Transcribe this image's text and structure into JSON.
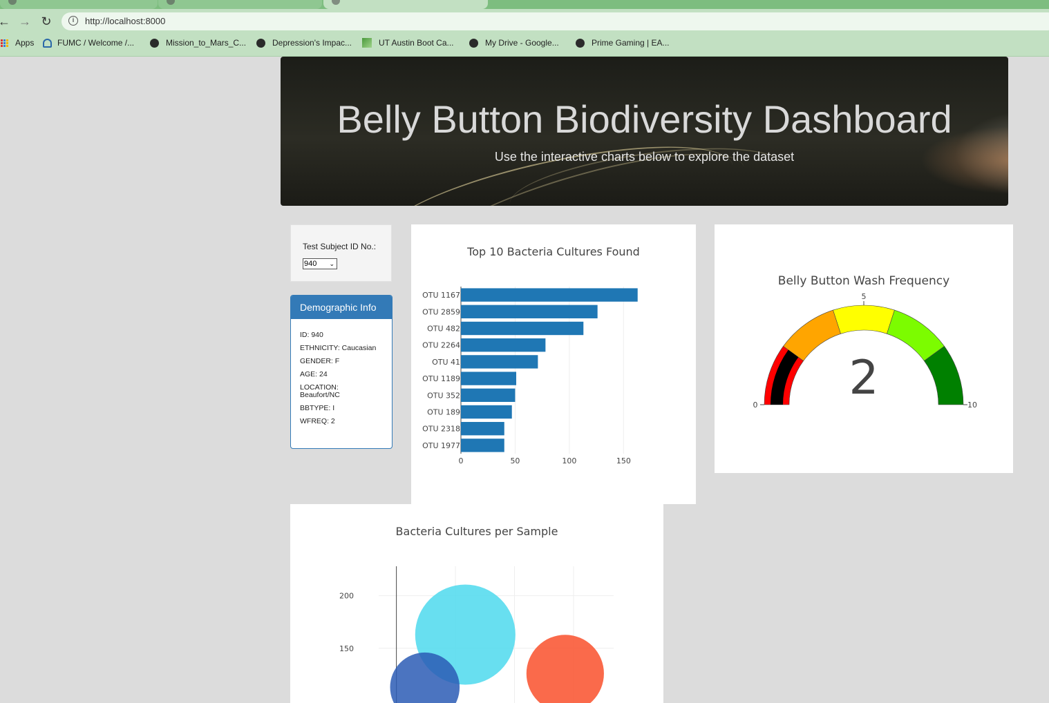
{
  "browser": {
    "url": "http://localhost:8000",
    "bookmarks": [
      {
        "label": "Apps",
        "icon": "apps-grid-icon"
      },
      {
        "label": "FUMC / Welcome /...",
        "icon": "fumc-logo-icon"
      },
      {
        "label": "Mission_to_Mars_C...",
        "icon": "globe-icon"
      },
      {
        "label": "Depression's Impac...",
        "icon": "globe-icon"
      },
      {
        "label": "UT Austin Boot Ca...",
        "icon": "ut-bootcamp-icon"
      },
      {
        "label": "My Drive - Google...",
        "icon": "globe-icon"
      },
      {
        "label": "Prime Gaming | EA...",
        "icon": "globe-icon"
      }
    ]
  },
  "header": {
    "title": "Belly Button Biodiversity Dashboard",
    "subtitle": "Use the interactive charts below to explore the dataset"
  },
  "selector": {
    "label": "Test Subject ID No.:",
    "value": "940"
  },
  "demographics": {
    "heading": "Demographic Info",
    "rows": [
      "ID: 940",
      "ETHNICITY: Caucasian",
      "GENDER: F",
      "AGE: 24",
      "LOCATION: Beaufort/NC",
      "BBTYPE: I",
      "WFREQ: 2"
    ]
  },
  "chart_data": [
    {
      "type": "bar",
      "orientation": "horizontal",
      "title": "Top 10 Bacteria Cultures Found",
      "categories": [
        "OTU 1167",
        "OTU 2859",
        "OTU 482",
        "OTU 2264",
        "OTU 41",
        "OTU 1189",
        "OTU 352",
        "OTU 189",
        "OTU 2318",
        "OTU 1977"
      ],
      "values": [
        163,
        126,
        113,
        78,
        71,
        51,
        50,
        47,
        40,
        40
      ],
      "xlim": [
        0,
        167
      ],
      "xticks": [
        0,
        50,
        100,
        150
      ],
      "grid": "vertical",
      "color": "#1f77b4"
    },
    {
      "type": "gauge",
      "title": "Belly Button Wash Frequency",
      "value": 2,
      "range": [
        0,
        10
      ],
      "ticks": [
        0,
        5,
        10
      ],
      "steps": [
        {
          "range": [
            0,
            2
          ],
          "color": "#ff0000"
        },
        {
          "range": [
            2,
            4
          ],
          "color": "#ffa500"
        },
        {
          "range": [
            4,
            6
          ],
          "color": "#ffff00"
        },
        {
          "range": [
            6,
            8
          ],
          "color": "#7cfc00"
        },
        {
          "range": [
            8,
            10
          ],
          "color": "#008000"
        }
      ],
      "bar_color": "#000000"
    },
    {
      "type": "scatter",
      "mode": "bubble",
      "title": "Bacteria Cultures per Sample",
      "yticks": [
        150,
        200
      ],
      "ylim": [
        98,
        228
      ],
      "xlim": [
        -300,
        3680
      ],
      "grid": true,
      "points": [
        {
          "x": 1167,
          "y": 163,
          "size": 163,
          "color": "#4dd9ed"
        },
        {
          "x": 482,
          "y": 113,
          "size": 113,
          "color": "#2b5cb5"
        },
        {
          "x": 2859,
          "y": 126,
          "size": 126,
          "color": "#f9502c"
        }
      ]
    }
  ]
}
